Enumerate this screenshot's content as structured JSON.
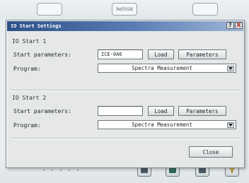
{
  "dialog": {
    "title": "IO Start Settings",
    "help_glyph": "?",
    "close_glyph": "X",
    "groups": [
      {
        "title": "IO Start 1",
        "start_label": "Start parameters:",
        "start_value": "ICE-0A6",
        "load_label": "Load",
        "params_label": "Parameters",
        "program_label": "Program:",
        "program_value": "Spectra Measurement"
      },
      {
        "title": "IO Start 2",
        "start_label": "Start parameters:",
        "start_value": "",
        "load_label": "Load",
        "params_label": "Parameters",
        "program_label": "Program:",
        "program_value": "Spectra Measurement"
      }
    ],
    "close_button": "Close"
  },
  "background": {
    "top_button_center": "Ref/S5B"
  },
  "colors": {
    "titlebar_start": "#2c4f86",
    "titlebar_end": "#9fb5d6",
    "dialog_bg": "#e6e8e7"
  }
}
